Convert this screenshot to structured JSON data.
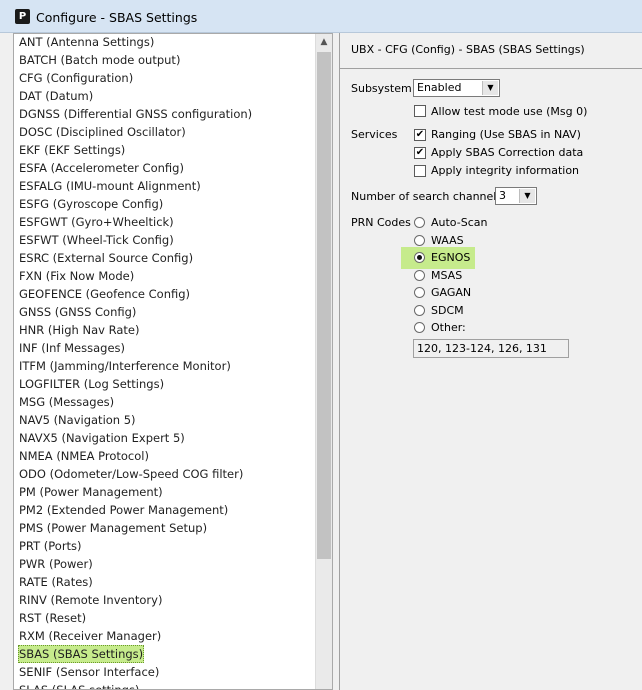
{
  "window": {
    "title": "Configure - SBAS Settings",
    "icon_letter": "P"
  },
  "list": {
    "items": [
      "ANT (Antenna Settings)",
      "BATCH (Batch mode output)",
      "CFG (Configuration)",
      "DAT (Datum)",
      "DGNSS (Differential GNSS configuration)",
      "DOSC (Disciplined Oscillator)",
      "EKF (EKF Settings)",
      "ESFA (Accelerometer Config)",
      "ESFALG (IMU-mount Alignment)",
      "ESFG (Gyroscope Config)",
      "ESFGWT (Gyro+Wheeltick)",
      "ESFWT (Wheel-Tick Config)",
      "ESRC (External Source Config)",
      "FXN (Fix Now Mode)",
      "GEOFENCE (Geofence Config)",
      "GNSS (GNSS Config)",
      "HNR (High Nav Rate)",
      "INF (Inf Messages)",
      "ITFM (Jamming/Interference Monitor)",
      "LOGFILTER (Log Settings)",
      "MSG (Messages)",
      "NAV5 (Navigation 5)",
      "NAVX5 (Navigation Expert 5)",
      "NMEA (NMEA Protocol)",
      "ODO (Odometer/Low-Speed COG filter)",
      "PM (Power Management)",
      "PM2 (Extended Power Management)",
      "PMS (Power Management Setup)",
      "PRT (Ports)",
      "PWR (Power)",
      "RATE (Rates)",
      "RINV (Remote Inventory)",
      "RST (Reset)",
      "RXM (Receiver Manager)",
      "SBAS (SBAS Settings)",
      "SENIF (Sensor Interface)",
      "SLAS (SLAS settings)"
    ],
    "selected": "SBAS (SBAS Settings)",
    "scroll_up_glyph": "▲"
  },
  "panel": {
    "header": "UBX - CFG (Config) - SBAS (SBAS Settings)",
    "subsystem_label": "Subsystem",
    "subsystem_value": "Enabled",
    "test_mode_label": "Allow test mode use (Msg 0)",
    "test_mode_checked": false,
    "services_label": "Services",
    "services": [
      {
        "label": "Ranging (Use SBAS in NAV)",
        "checked": true
      },
      {
        "label": "Apply SBAS Correction data",
        "checked": true
      },
      {
        "label": "Apply integrity information",
        "checked": false
      }
    ],
    "channels_label": "Number of search channels",
    "channels_value": "3",
    "prn_label": "PRN Codes",
    "prn_options": [
      "Auto-Scan",
      "WAAS",
      "EGNOS",
      "MSAS",
      "GAGAN",
      "SDCM",
      "Other:"
    ],
    "prn_selected": "EGNOS",
    "other_value": "120, 123-124, 126, 131",
    "check_glyph": "✔",
    "dropdown_glyph": "▼"
  },
  "colors": {
    "selection_highlight": "#c6eb8c",
    "titlebar": "#d6e4f3"
  }
}
